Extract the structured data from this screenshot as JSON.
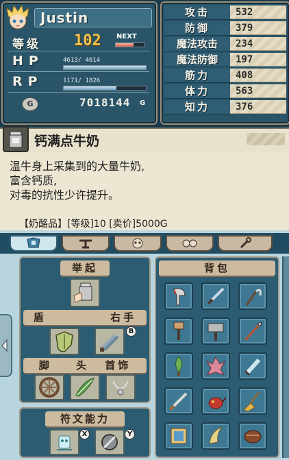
{
  "character": {
    "name": "Justin",
    "level_label": "等级",
    "level": "102",
    "next_label": "NEXT",
    "hp_label": "HP",
    "hp": "4613/ 4614",
    "rp_label": "RP",
    "rp": "1171/ 1826",
    "gold": "7018144",
    "gold_unit": "G"
  },
  "stats": [
    {
      "label": "攻击",
      "value": "532"
    },
    {
      "label": "防御",
      "value": "379"
    },
    {
      "label": "魔法攻击",
      "value": "234"
    },
    {
      "label": "魔法防御",
      "value": "197"
    },
    {
      "label": "筋力",
      "value": "408"
    },
    {
      "label": "体力",
      "value": "563"
    },
    {
      "label": "知力",
      "value": "376"
    }
  ],
  "item": {
    "name": "钙满点牛奶",
    "description": [
      "温牛身上采集到的大量牛奶,",
      "富含钙质,",
      "对毒的抗性少许提升。"
    ],
    "footer": "【奶酪品】[等级]10 [卖价]5000G"
  },
  "tabs": [
    {
      "icon": "armor-tab-icon"
    },
    {
      "icon": "weapon-tab-icon"
    },
    {
      "icon": "skull-tab-icon"
    },
    {
      "icon": "mask-tab-icon"
    },
    {
      "icon": "tool-tab-icon"
    }
  ],
  "equipment": {
    "raise_label": "举起",
    "shield_label": "盾",
    "right_hand_label": "右手",
    "feet_label": "脚",
    "head_label": "头",
    "accessory_label": "首饰",
    "rune_label": "符文能力",
    "badge_b": "B",
    "badge_x": "X",
    "badge_y": "Y"
  },
  "bag": {
    "label": "背包",
    "items": [
      "axe-icon",
      "sword-icon",
      "sickle-icon",
      "hammer-icon",
      "big-hammer-icon",
      "spear-icon",
      "leaf-sword-icon",
      "crystal-icon",
      "broadsword-icon",
      "saber-icon",
      "teapot-icon",
      "broom-icon",
      "book-icon",
      "claw-icon",
      "brush-icon"
    ]
  },
  "colors": {
    "panel": "#2a5468",
    "parchment": "#e4dcc4",
    "accent_gold": "#f2c14e"
  }
}
